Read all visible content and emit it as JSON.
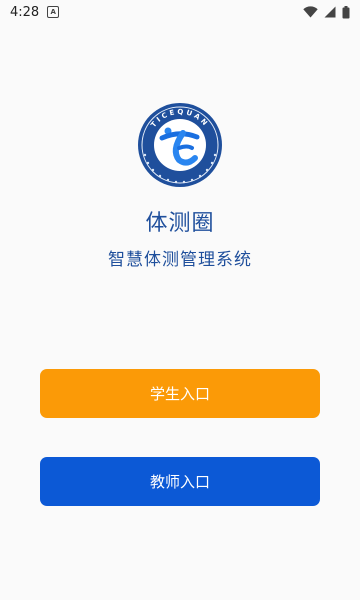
{
  "status_bar": {
    "time": "4:28",
    "notification_badge": "A"
  },
  "logo": {
    "ring_text": "TICEQUAN",
    "primary_color": "#1a6fe0",
    "accent_color": "#1f4f9c"
  },
  "app": {
    "title": "体测圈",
    "subtitle": "智慧体测管理系统"
  },
  "buttons": {
    "student_entry": "学生入口",
    "teacher_entry": "教师入口",
    "student_color": "#fb9a07",
    "teacher_color": "#0c59d6"
  }
}
